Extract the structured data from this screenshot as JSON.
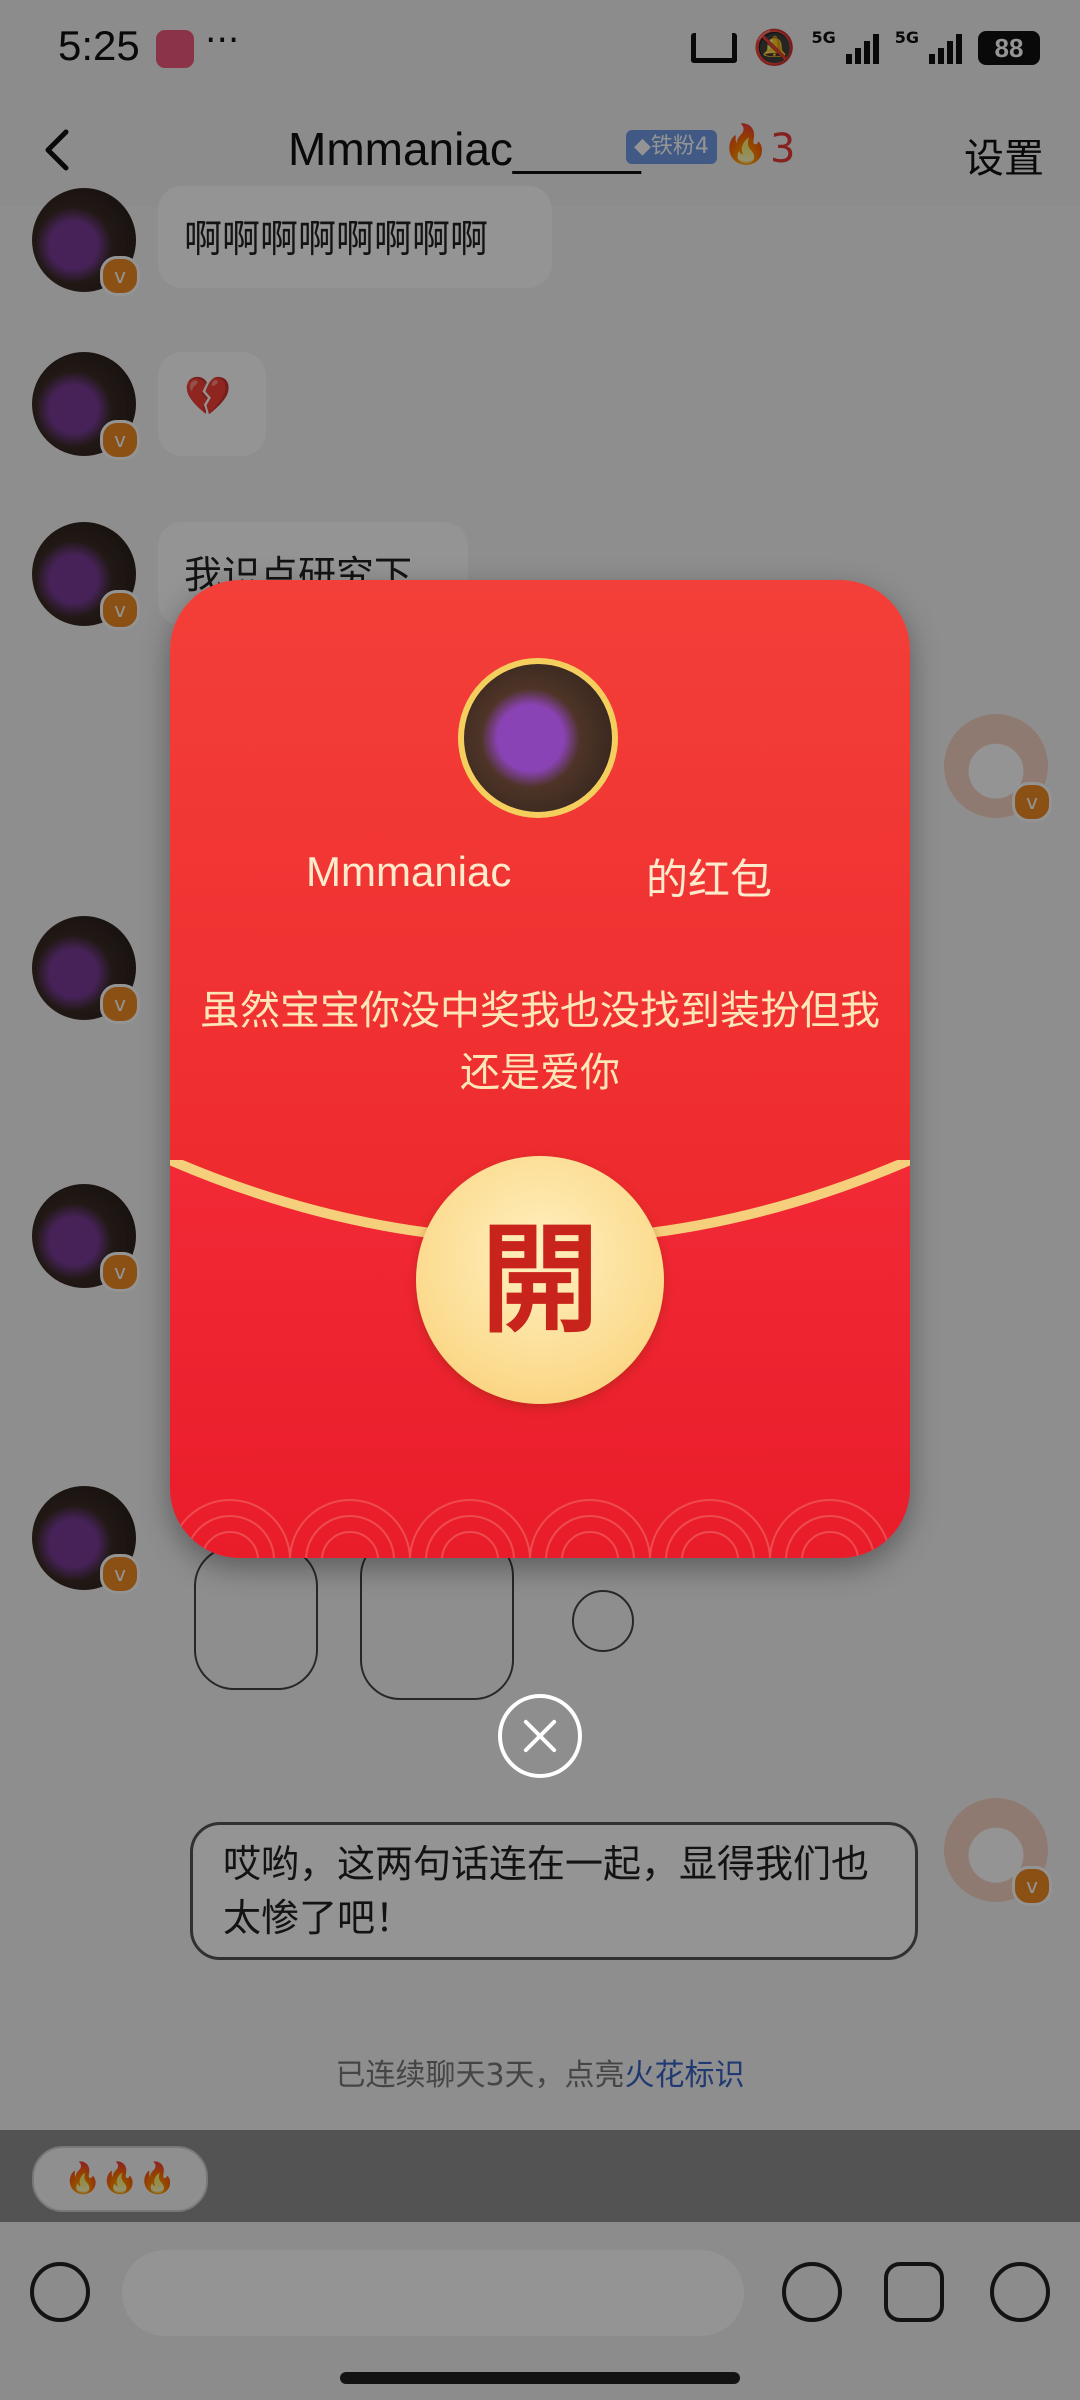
{
  "status_bar": {
    "time": "5:25",
    "dots": "···",
    "battery": "88",
    "network": "5G"
  },
  "nav": {
    "title": "Mmmaniac_____",
    "badge": "◆铁粉4",
    "fire_icon": "🔥",
    "streak": "3",
    "settings": "设置"
  },
  "messages": [
    {
      "text": "啊啊啊啊啊啊啊啊"
    },
    {
      "text": "💔"
    },
    {
      "text": "我识点研究下"
    },
    {
      "text": "哎哟，这两句话连在一起，显得我们也太惨了吧！"
    }
  ],
  "streak_notice": {
    "prefix": "已连续聊天3天，点亮",
    "link": "火花标识"
  },
  "fire_chip": "🔥🔥🔥",
  "input": {
    "placeholder": ""
  },
  "red_packet": {
    "sender": "Mmmaniac",
    "suffix": "的红包",
    "message": "虽然宝宝你没中奖我也没找到装扮但我还是爱你",
    "open_label": "開"
  },
  "colors": {
    "packet_red": "#ef2d2f",
    "gold": "#fbd98a",
    "link_blue": "#3a63c4"
  }
}
